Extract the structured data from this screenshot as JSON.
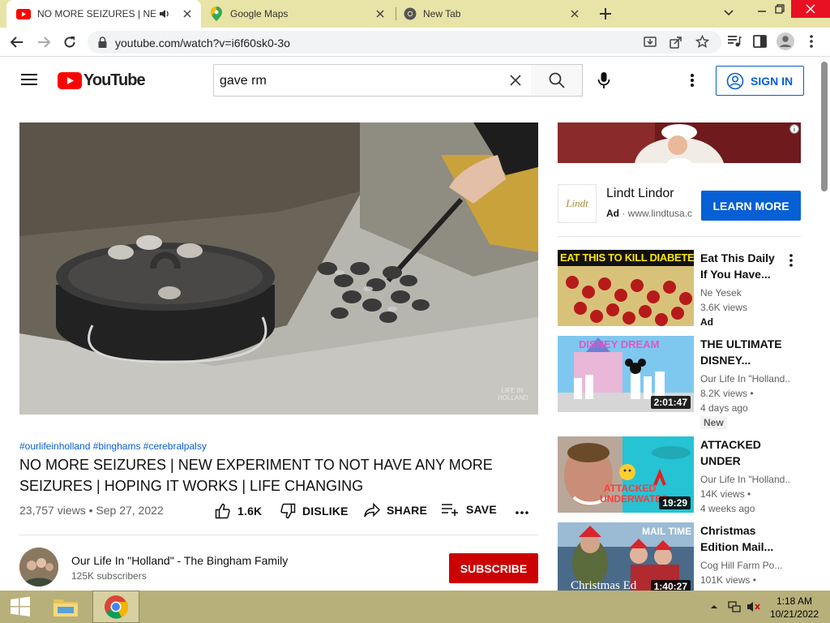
{
  "browser": {
    "tabs": [
      {
        "title": "NO MORE SEIZURES | NEW E",
        "icon": "youtube-icon"
      },
      {
        "title": "Google Maps",
        "icon": "maps-icon"
      },
      {
        "title": "New Tab",
        "icon": "chrome-icon"
      }
    ],
    "url": "youtube.com/watch?v=i6f60sk0-3o"
  },
  "youtube": {
    "logo_text": "YouTube",
    "search_query": "gave rm",
    "sign_in": "SIGN IN"
  },
  "video": {
    "hashtags": "#ourlifeinholland #binghams #cerebralpalsy",
    "title": "NO MORE SEIZURES | NEW EXPERIMENT TO NOT HAVE ANY MORE SEIZURES | HOPING IT WORKS | LIFE CHANGING",
    "views_date": "23,757 views • Sep 27, 2022",
    "likes": "1.6K",
    "dislike": "DISLIKE",
    "share": "SHARE",
    "save": "SAVE",
    "watermark": "LIFE IN HOLLAND"
  },
  "channel": {
    "name": "Our Life In \"Holland\" - The Bingham Family",
    "subscribers": "125K subscribers",
    "subscribe": "SUBSCRIBE"
  },
  "ad": {
    "title": "Lindt Lindor",
    "ad_label": "Ad",
    "ad_url": "www.lindtusa.com",
    "cta": "LEARN MORE",
    "logo_text": "Lindt"
  },
  "related": [
    {
      "thumb_text": "EAT THIS TO KILL DIABETES",
      "title": "Eat This Daily If You Have...",
      "channel": "Ne Yesek",
      "views": "3.6K views",
      "extra": "Ad"
    },
    {
      "thumb_text": "DISNEY DREAM",
      "title": "THE ULTIMATE DISNEY...",
      "channel": "Our Life In \"Holland...",
      "views": "8.2K views •",
      "age": "4 days ago",
      "badge": "New",
      "duration": "2:01:47"
    },
    {
      "thumb_text": "ATTACKED UNDERWATER",
      "title": "ATTACKED UNDER WATE...",
      "channel": "Our Life In \"Holland...",
      "views": "14K views •",
      "age": "4 weeks ago",
      "duration": "19:29"
    },
    {
      "thumb_text": "MAIL TIME",
      "thumb_text2": "Christmas Ed",
      "title": "Christmas Edition Mail...",
      "channel": "Cog Hill Farm Po...",
      "views": "101K views •",
      "duration": "1:40:27"
    }
  ],
  "taskbar": {
    "time": "1:18 AM",
    "date": "10/21/2022"
  }
}
